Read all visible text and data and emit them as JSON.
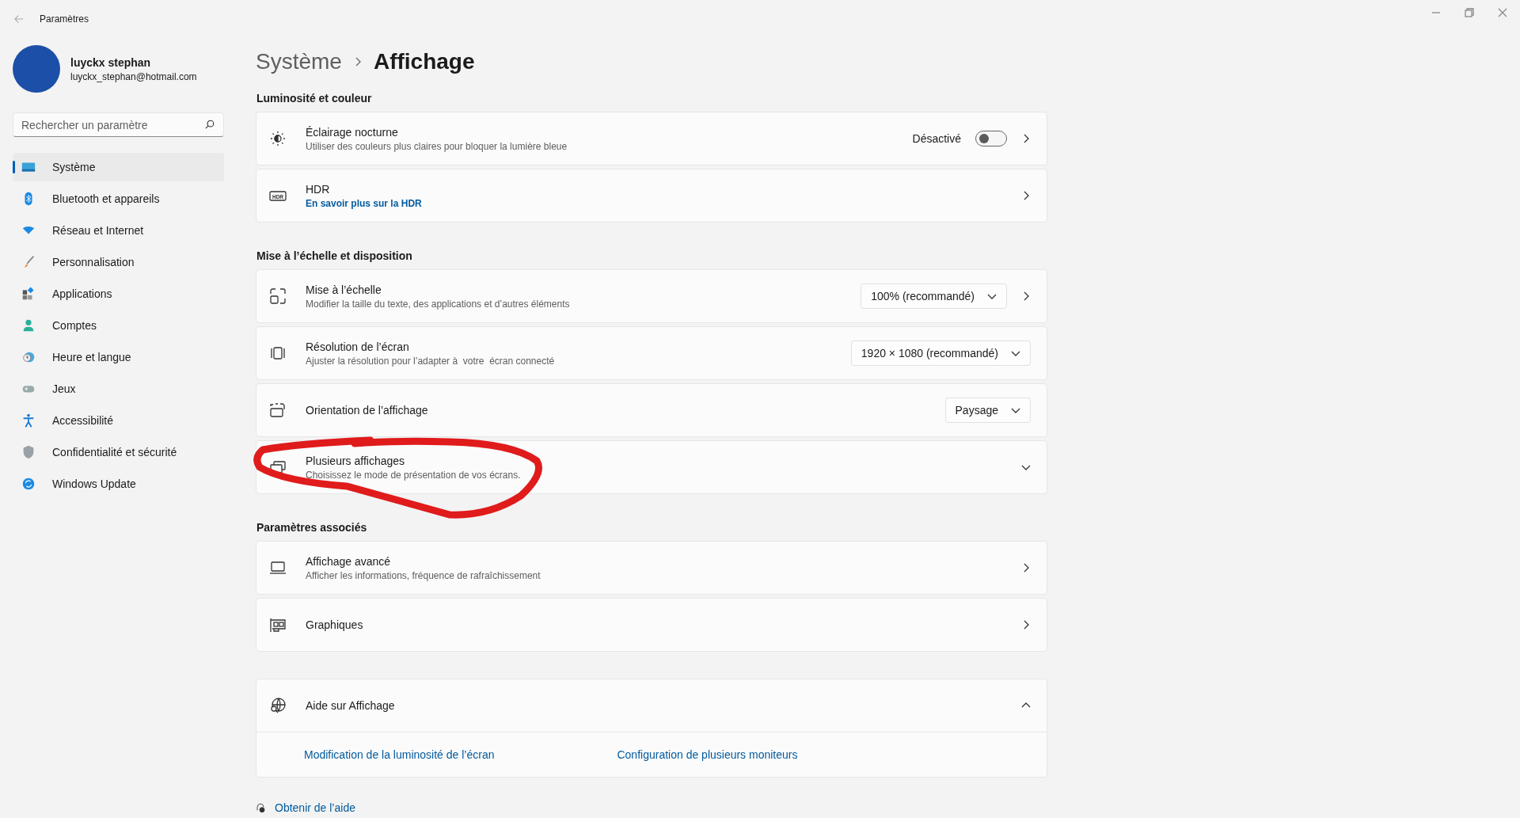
{
  "window": {
    "title": "Paramètres"
  },
  "account": {
    "name": "luyckx stephan",
    "email": "luyckx_stephan@hotmail.com"
  },
  "search": {
    "placeholder": "Rechercher un paramètre"
  },
  "sidebar": {
    "items": [
      {
        "label": "Système",
        "selected": true
      },
      {
        "label": "Bluetooth et appareils",
        "selected": false
      },
      {
        "label": "Réseau et Internet",
        "selected": false
      },
      {
        "label": "Personnalisation",
        "selected": false
      },
      {
        "label": "Applications",
        "selected": false
      },
      {
        "label": "Comptes",
        "selected": false
      },
      {
        "label": "Heure et langue",
        "selected": false
      },
      {
        "label": "Jeux",
        "selected": false
      },
      {
        "label": "Accessibilité",
        "selected": false
      },
      {
        "label": "Confidentialité et sécurité",
        "selected": false
      },
      {
        "label": "Windows Update",
        "selected": false
      }
    ]
  },
  "breadcrumb": {
    "parent": "Système",
    "current": "Affichage"
  },
  "sections": [
    {
      "title": "Luminosité et couleur",
      "rows": [
        {
          "kind": "toggle",
          "title": "Éclairage nocturne",
          "subtitle": "Utiliser des couleurs plus claires pour bloquer la lumière bleue",
          "state_label": "Désactivé",
          "on": false
        },
        {
          "kind": "nav",
          "icon_label": "HDR",
          "title": "HDR",
          "link": "En savoir plus sur la HDR"
        }
      ]
    },
    {
      "title": "Mise à l’échelle et disposition",
      "rows": [
        {
          "kind": "dropdown",
          "title": "Mise à l’échelle",
          "subtitle": "Modifier la taille du texte, des applications et d’autres éléments",
          "value": "100% (recommandé)",
          "chevron": true
        },
        {
          "kind": "dropdown",
          "title": "Résolution de l’écran",
          "subtitle": "Ajuster la résolution pour l’adapter à  votre  écran connecté",
          "value": "1920 × 1080 (recommandé)",
          "chevron": false
        },
        {
          "kind": "dropdown",
          "title": "Orientation de l’affichage",
          "value": "Paysage",
          "chevron": false
        },
        {
          "kind": "expander",
          "title": "Plusieurs affichages",
          "subtitle": "Choisissez le mode de présentation de vos écrans.",
          "expanded": false,
          "circled": true
        }
      ]
    },
    {
      "title": "Paramètres associés",
      "rows": [
        {
          "kind": "nav",
          "title": "Affichage avancé",
          "subtitle": "Afficher les informations, fréquence de rafraîchissement"
        },
        {
          "kind": "nav",
          "title": "Graphiques"
        }
      ]
    }
  ],
  "help": {
    "title": "Aide sur Affichage",
    "expanded": true,
    "links": [
      "Modification de la luminosité de l’écran",
      "Configuration de plusieurs moniteurs"
    ]
  },
  "get_help": "Obtenir de l’aide"
}
